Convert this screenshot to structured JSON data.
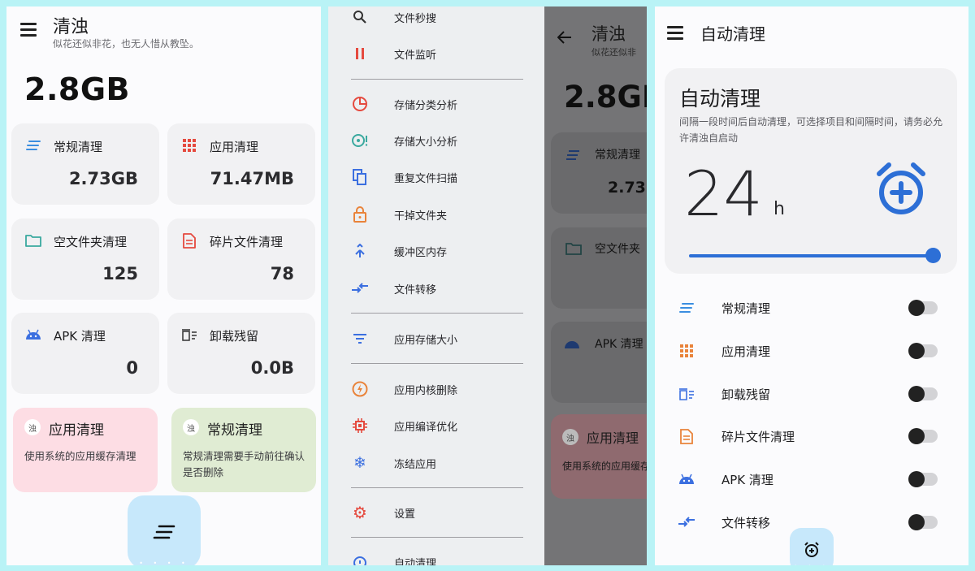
{
  "colors": {
    "accent_blue": "#2d6fd6",
    "tile_pink": "#fddde4",
    "tile_green": "#e0ecd3",
    "fab_blue": "#c7e8fb",
    "red_icon": "#e54a3f",
    "orange_icon": "#e9833a"
  },
  "screen1": {
    "title": "清浊",
    "subtitle": "似花还似非花，也无人惜从教坠。",
    "total_size": "2.8GB",
    "cards": [
      {
        "label": "常规清理",
        "value": "2.73GB",
        "icon": "lines-icon"
      },
      {
        "label": "应用清理",
        "value": "71.47MB",
        "icon": "grid-icon"
      },
      {
        "label": "空文件夹清理",
        "value": "125",
        "icon": "folder-icon"
      },
      {
        "label": "碎片文件清理",
        "value": "78",
        "icon": "document-icon"
      },
      {
        "label": "APK 清理",
        "value": "0",
        "icon": "android-icon"
      },
      {
        "label": "卸载残留",
        "value": "0.0B",
        "icon": "trash-list-icon"
      }
    ],
    "tiles": [
      {
        "badge": "浊",
        "title": "应用清理",
        "desc": "使用系统的应用缓存清理"
      },
      {
        "badge": "浊",
        "title": "常规清理",
        "desc": "常规清理需要手动前往确认是否删除"
      }
    ],
    "fab_icon": "clean-lines-icon"
  },
  "screen2": {
    "menu": [
      {
        "label": "文件秒搜",
        "icon": "search-icon"
      },
      {
        "label": "文件监听",
        "icon": "pause-icon"
      },
      {
        "label": "存储分类分析",
        "icon": "pie-chart-icon"
      },
      {
        "label": "存储大小分析",
        "icon": "storage-size-icon"
      },
      {
        "label": "重复文件扫描",
        "icon": "copy-icon"
      },
      {
        "label": "干掉文件夹",
        "icon": "lock-icon"
      },
      {
        "label": "缓冲区内存",
        "icon": "merge-icon"
      },
      {
        "label": "文件转移",
        "icon": "transfer-icon"
      },
      {
        "label": "应用存储大小",
        "icon": "filter-icon"
      },
      {
        "label": "应用内核删除",
        "icon": "flash-icon"
      },
      {
        "label": "应用编译优化",
        "icon": "chip-icon"
      },
      {
        "label": "冻结应用",
        "icon": "snowflake-icon"
      },
      {
        "label": "设置",
        "icon": "gear-icon"
      },
      {
        "label": "自动清理",
        "icon": "alarm-icon"
      }
    ],
    "peek": {
      "title": "清浊",
      "subtitle": "似花还似非",
      "total_size": "2.8GI",
      "card1_label": "常规清理",
      "card1_value": "2.73",
      "card2_label": "空文件夹",
      "card3_label": "APK 清理",
      "tile_badge": "浊",
      "tile_title": "应用清理",
      "tile_desc": "使用系统的应用缓存清理"
    }
  },
  "screen3": {
    "title": "自动清理",
    "card_title": "自动清理",
    "card_desc": "间隔一段时间后自动清理，可选择项目和间隔时间，请务必允许清浊自启动",
    "hours": "24",
    "unit": "h",
    "interval_fraction": 1.0,
    "items": [
      {
        "label": "常规清理",
        "icon": "lines-icon",
        "enabled": false
      },
      {
        "label": "应用清理",
        "icon": "grid-icon",
        "enabled": false
      },
      {
        "label": "卸载残留",
        "icon": "trash-list-icon",
        "enabled": false
      },
      {
        "label": "碎片文件清理",
        "icon": "document-icon",
        "enabled": false
      },
      {
        "label": "APK 清理",
        "icon": "android-icon",
        "enabled": false
      },
      {
        "label": "文件转移",
        "icon": "transfer-icon",
        "enabled": false
      }
    ]
  }
}
